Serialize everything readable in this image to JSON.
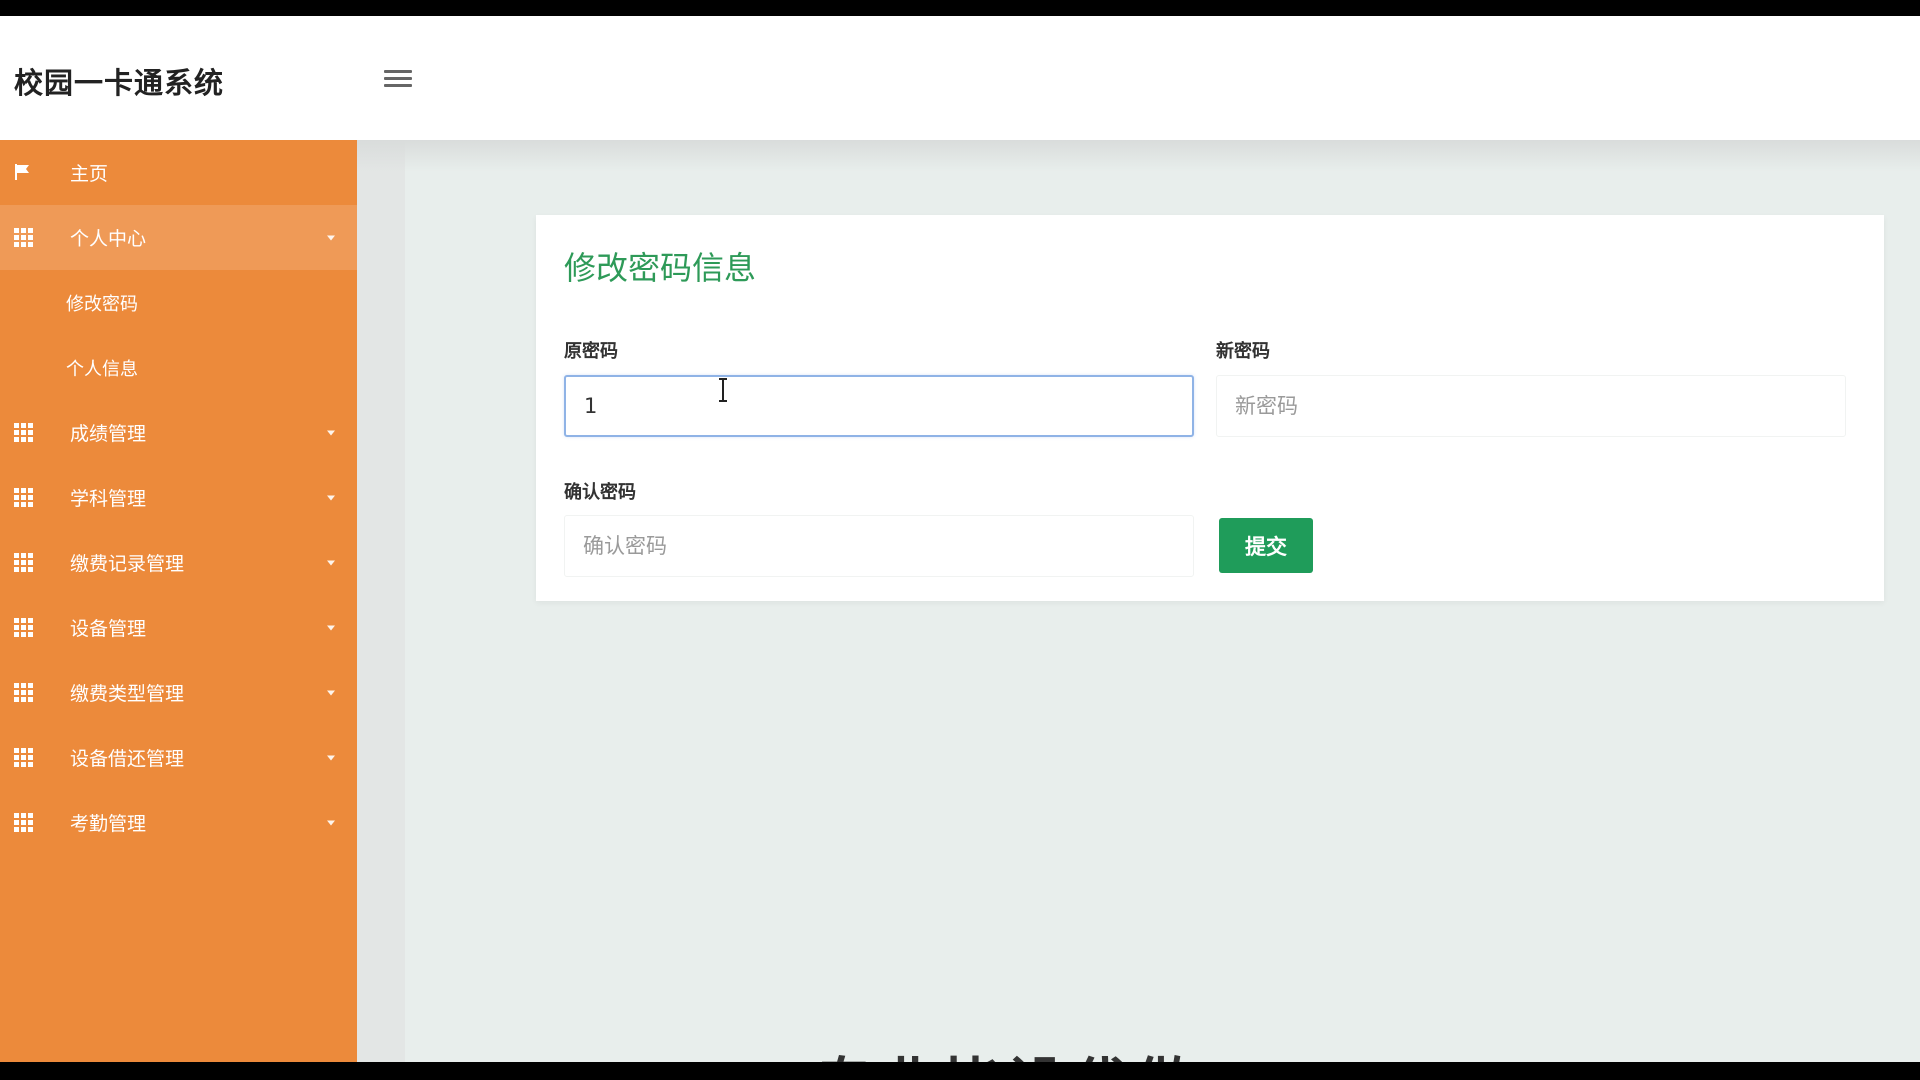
{
  "app": {
    "title": "校园一卡通系统"
  },
  "sidebar": {
    "home": {
      "label": "主页",
      "icon": "flag-icon"
    },
    "personal_center": {
      "label": "个人中心",
      "sub_items": [
        {
          "label": "修改密码"
        },
        {
          "label": "个人信息"
        }
      ]
    },
    "sections": [
      {
        "label": "成绩管理"
      },
      {
        "label": "学科管理"
      },
      {
        "label": "缴费记录管理"
      },
      {
        "label": "设备管理"
      },
      {
        "label": "缴费类型管理"
      },
      {
        "label": "设备借还管理"
      },
      {
        "label": "考勤管理"
      }
    ]
  },
  "form": {
    "title": "修改密码信息",
    "old_password": {
      "label": "原密码",
      "value": "1"
    },
    "new_password": {
      "label": "新密码",
      "placeholder": "新密码"
    },
    "confirm_password": {
      "label": "确认密码",
      "placeholder": "确认密码"
    },
    "submit_label": "提交"
  },
  "footer_overlay": {
    "text": "专业毕设代做"
  },
  "colors": {
    "sidebar": "#ec8a3b",
    "accent": "#2e9a58",
    "submit": "#1f9c5a"
  }
}
